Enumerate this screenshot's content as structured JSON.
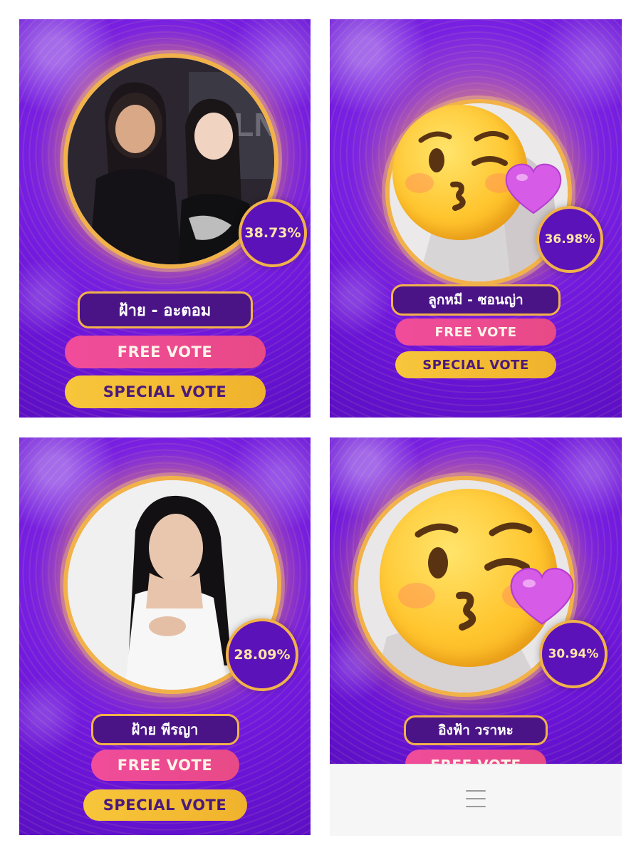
{
  "cards": [
    {
      "name": "ฝ้าย - อะตอม",
      "percent": "38.73%",
      "free_vote_label": "FREE VOTE",
      "special_vote_label": "SPECIAL VOTE",
      "photo": "two-women-photo"
    },
    {
      "name": "ลูกหมี - ซอนญ่า",
      "percent": "36.98%",
      "free_vote_label": "FREE VOTE",
      "special_vote_label": "SPECIAL VOTE",
      "photo": "face-blowing-kiss-emoji-over-photo"
    },
    {
      "name": "ฝ้าย พีรญา",
      "percent": "28.09%",
      "free_vote_label": "FREE VOTE",
      "special_vote_label": "SPECIAL VOTE",
      "photo": "woman-portrait-photo"
    },
    {
      "name": "อิงฟ้า วราหะ",
      "percent": "30.94%",
      "free_vote_label": "FREE VOTE",
      "photo": "face-blowing-kiss-emoji-over-photo"
    }
  ],
  "footer": {
    "icon": "hamburger-menu-icon"
  },
  "colors": {
    "card_purple": "#6a14d8",
    "gold": "#f2b24a",
    "free_pink": "#e84a86",
    "special_yellow": "#f0b22c",
    "name_pill": "#4a1487"
  }
}
